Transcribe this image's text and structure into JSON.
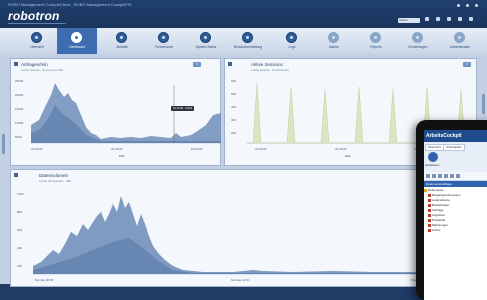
{
  "window": {
    "title": "ROBO Management Cockpit/Client - ROBO Management Cockpit/FIS",
    "logo": "robotron",
    "search_placeholder": "Suche"
  },
  "nav": {
    "items": [
      {
        "label": "Übersicht",
        "active": false
      },
      {
        "label": "Dashboard",
        "active": true
      },
      {
        "label": "Aktivität",
        "active": false
      },
      {
        "label": "Performance",
        "active": false
      },
      {
        "label": "System-Status",
        "active": false
      },
      {
        "label": "Benutzerverwaltung",
        "active": false
      },
      {
        "label": "Logs",
        "active": false
      },
      {
        "label": "Alarme",
        "active": false
      },
      {
        "label": "Reports",
        "active": false
      },
      {
        "label": "Einstellungen",
        "active": false
      },
      {
        "label": "Administration",
        "active": false
      }
    ]
  },
  "panels": {
    "p1": {
      "title": "Anfragen/min",
      "subtitle": "Letzte Stunde · Summe pro Min",
      "button": "▾",
      "x_label": "Zeit",
      "ticks_x": [
        "09:00:00",
        "09:30:00",
        "10:00:00"
      ],
      "ticks_y": [
        "25000",
        "20000",
        "15000",
        "10000",
        "5000",
        "0"
      ],
      "tooltip": "10:12:00 · 9.834"
    },
    "p2": {
      "title": "Aktive Sessions",
      "subtitle": "Letzte Stunde · Durchschnitt",
      "button": "▾",
      "x_label": "Zeit",
      "ticks_x": [
        "09:00:00",
        "09:30:00",
        "10:00:00"
      ],
      "ticks_y": [
        "600",
        "500",
        "400",
        "300",
        "200",
        "100"
      ]
    },
    "p3": {
      "title": "Datenvolumen",
      "subtitle": "Letzte 24 Stunden · MB",
      "button": "▾",
      "ticks_x": [
        "Montag 00:00",
        "Montag 12:00",
        "Dienstag 00:00"
      ],
      "ticks_y": [
        "1000",
        "800",
        "600",
        "400",
        "200"
      ]
    }
  },
  "tablet": {
    "app_title": "ArbeitsCockpit",
    "tabs": [
      "Übersicht",
      "Arbeitsplatz"
    ],
    "button_label": "Aktualisieren",
    "section": "Dokumentenablage",
    "tree": [
      {
        "label": "Dokumente",
        "type": "folder"
      },
      {
        "label": "Eingangsrechnungen",
        "type": "file"
      },
      {
        "label": "Lieferscheine",
        "type": "file"
      },
      {
        "label": "Bestellungen",
        "type": "file"
      },
      {
        "label": "Verträge",
        "type": "file"
      },
      {
        "label": "Angebote",
        "type": "file"
      },
      {
        "label": "Protokolle",
        "type": "file"
      },
      {
        "label": "Mahnungen",
        "type": "file"
      },
      {
        "label": "Archiv",
        "type": "file"
      }
    ]
  }
}
